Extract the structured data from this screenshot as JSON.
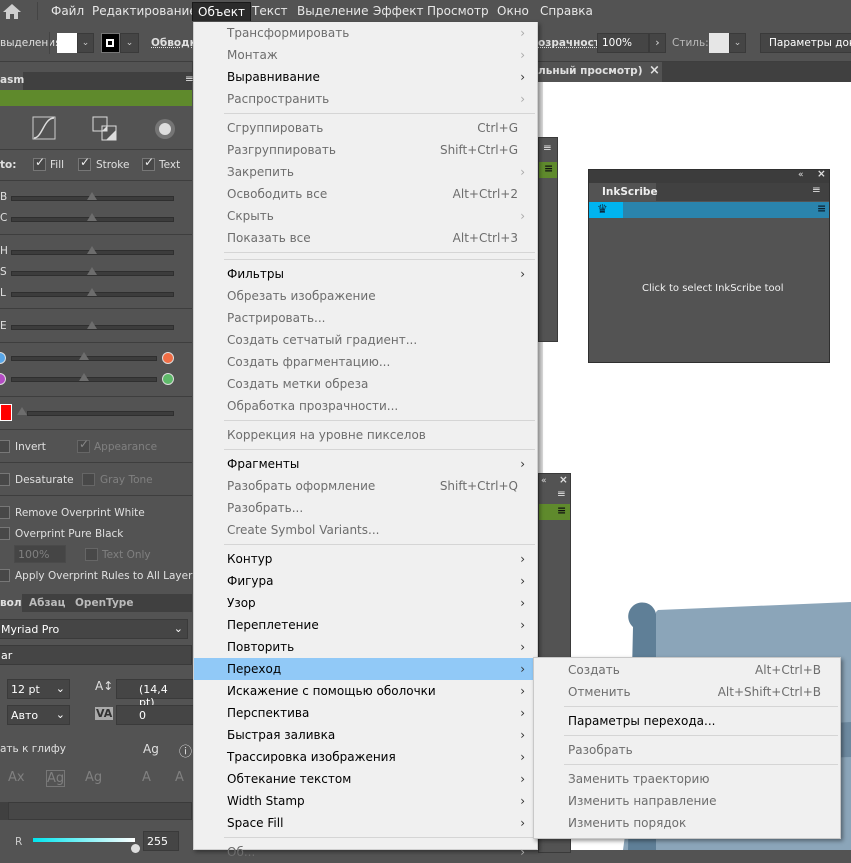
{
  "menubar": {
    "items": [
      "Файл",
      "Редактирование",
      "Объект",
      "Текст",
      "Выделение",
      "Эффект",
      "Просмотр",
      "Окно",
      "Справка"
    ],
    "active": "Объект"
  },
  "control": {
    "selection_label": "выделения",
    "stroke_label": "Обводка",
    "opacity_label": "озрачность:",
    "opacity_value": "100%",
    "style_label": "Стиль:",
    "doc_settings": "Параметры докум"
  },
  "doc_tab": {
    "title": "льный просмотр)",
    "close": "×"
  },
  "left_panel": {
    "tab": "asm",
    "accent": "#5f8a2c",
    "apply_to_label": "to:",
    "checks": [
      "Fill",
      "Stroke",
      "Text"
    ],
    "slider_labels": [
      "B",
      "C",
      "H",
      "S",
      "L",
      "E"
    ],
    "invert": "Invert",
    "appearance": "Appearance",
    "desaturate": "Desaturate",
    "gray_tone": "Gray Tone",
    "remove_overprint": "Remove Overprint White",
    "overprint_black": "Overprint Pure Black",
    "percent": "100%",
    "text_only": "Text Only",
    "apply_rules": "Apply Overprint Rules to All Layers",
    "swatch_color": "#ff0000"
  },
  "char_panel": {
    "tabs": [
      "вол",
      "Абзац",
      "OpenType"
    ],
    "font": "Myriad Pro",
    "style": "ar",
    "size": "12 pt",
    "leading": "(14,4 pt)",
    "kerning": "Авто",
    "tracking": "0",
    "snap": "ать к глифу"
  },
  "color_panel": {
    "r_label": "R",
    "r_value": "255"
  },
  "inkscribe": {
    "title": "InkScribe",
    "hint": "Click to select InkScribe tool",
    "accent": "#2a84ad"
  },
  "menu": {
    "items": [
      {
        "label": "Трансформировать",
        "sub": true,
        "disabled": true
      },
      {
        "label": "Монтаж",
        "sub": true,
        "disabled": true
      },
      {
        "label": "Выравнивание",
        "sub": true
      },
      {
        "label": "Распространить",
        "sub": true,
        "disabled": true
      },
      {
        "sep": true
      },
      {
        "label": "Сгруппировать",
        "key": "Ctrl+G",
        "disabled": true
      },
      {
        "label": "Разгруппировать",
        "key": "Shift+Ctrl+G",
        "disabled": true
      },
      {
        "label": "Закрепить",
        "sub": true,
        "disabled": true
      },
      {
        "label": "Освободить все",
        "key": "Alt+Ctrl+2",
        "disabled": true
      },
      {
        "label": "Скрыть",
        "sub": true,
        "disabled": true
      },
      {
        "label": "Показать все",
        "key": "Alt+Ctrl+3",
        "disabled": true
      },
      {
        "sep": true,
        "double": true
      },
      {
        "label": "Фильтры",
        "sub": true
      },
      {
        "label": "Обрезать изображение",
        "disabled": true
      },
      {
        "label": "Растрировать...",
        "disabled": true
      },
      {
        "label": "Создать сетчатый градиент...",
        "disabled": true
      },
      {
        "label": "Создать фрагментацию...",
        "disabled": true
      },
      {
        "label": "Создать метки обреза",
        "disabled": true
      },
      {
        "label": "Обработка прозрачности...",
        "disabled": true
      },
      {
        "sep": true
      },
      {
        "label": "Коррекция на уровне пикселов",
        "disabled": true
      },
      {
        "sep": true
      },
      {
        "label": "Фрагменты",
        "sub": true
      },
      {
        "label": "Разобрать оформление",
        "key": "Shift+Ctrl+Q",
        "disabled": true
      },
      {
        "label": "Разобрать...",
        "disabled": true
      },
      {
        "label": "Create Symbol Variants...",
        "disabled": true
      },
      {
        "sep": true
      },
      {
        "label": "Контур",
        "sub": true
      },
      {
        "label": "Фигура",
        "sub": true
      },
      {
        "label": "Узор",
        "sub": true
      },
      {
        "label": "Переплетение",
        "sub": true
      },
      {
        "label": "Повторить",
        "sub": true
      },
      {
        "label": "Переход",
        "sub": true,
        "highlighted": true
      },
      {
        "label": "Искажение с помощью оболочки",
        "sub": true
      },
      {
        "label": "Перспектива",
        "sub": true
      },
      {
        "label": "Быстрая заливка",
        "sub": true
      },
      {
        "label": "Трассировка изображения",
        "sub": true
      },
      {
        "label": "Обтекание текстом",
        "sub": true
      },
      {
        "label": "Width Stamp",
        "sub": true
      },
      {
        "label": "Space Fill",
        "sub": true
      },
      {
        "sep": true
      },
      {
        "label": "Об...",
        "sub": true,
        "disabled": true
      }
    ]
  },
  "submenu": {
    "items": [
      {
        "label": "Создать",
        "key": "Alt+Ctrl+B",
        "disabled": true
      },
      {
        "label": "Отменить",
        "key": "Alt+Shift+Ctrl+B",
        "disabled": true
      },
      {
        "sep": true
      },
      {
        "label": "Параметры перехода..."
      },
      {
        "sep": true
      },
      {
        "label": "Разобрать",
        "disabled": true
      },
      {
        "sep": true
      },
      {
        "label": "Заменить траекторию",
        "disabled": true
      },
      {
        "label": "Изменить направление",
        "disabled": true
      },
      {
        "label": "Изменить порядок",
        "disabled": true
      }
    ]
  },
  "icons": {
    "arrow": "›",
    "close": "×",
    "collapse": "«"
  }
}
